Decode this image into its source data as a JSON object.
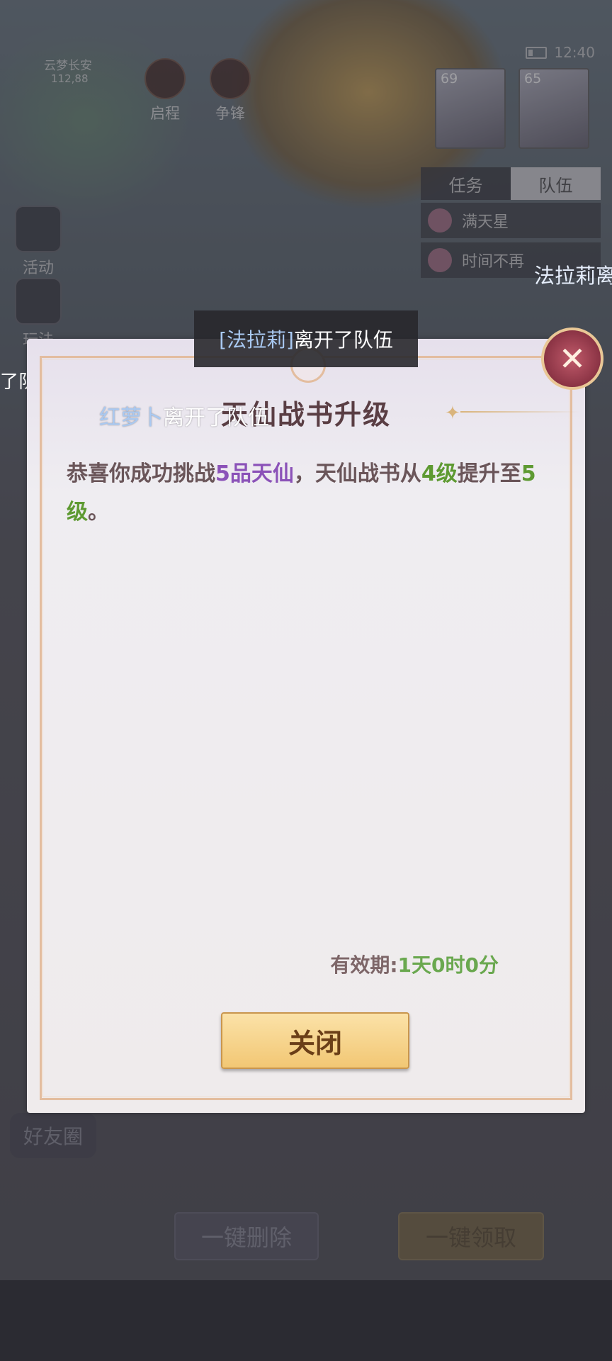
{
  "hud": {
    "map_name": "云梦长安",
    "map_coord": "112,88",
    "btn_qicheng": "启程",
    "btn_zhengfeng": "争锋",
    "time": "12:40",
    "avatar1_level": "69",
    "avatar2_level": "65"
  },
  "side": {
    "activity": "活动",
    "play": "玩法"
  },
  "team": {
    "tab_task": "任务",
    "tab_team": "队伍",
    "member1": "满天星",
    "member2": "时间不再"
  },
  "floating": {
    "left_text": "了队伍",
    "right_text": "法拉莉离"
  },
  "toast": {
    "name": "[法拉莉]",
    "text": "离开了队伍"
  },
  "dialog": {
    "title": "天仙战书升级",
    "overlay_name": "红萝卜",
    "overlay_text": "离开了队伍",
    "msg_1": "恭喜你成功挑战",
    "msg_rank": "5品天仙",
    "msg_2": "，天仙战书从",
    "msg_from": "4级",
    "msg_3": "提升至",
    "msg_to": "5级",
    "msg_4": "。",
    "validity_label": "有效期:",
    "validity_value": "1天0时0分",
    "close_label": "关闭"
  },
  "bottom": {
    "friend_circle": "好友圈",
    "delete_all": "一键删除",
    "claim_all": "一键领取"
  }
}
